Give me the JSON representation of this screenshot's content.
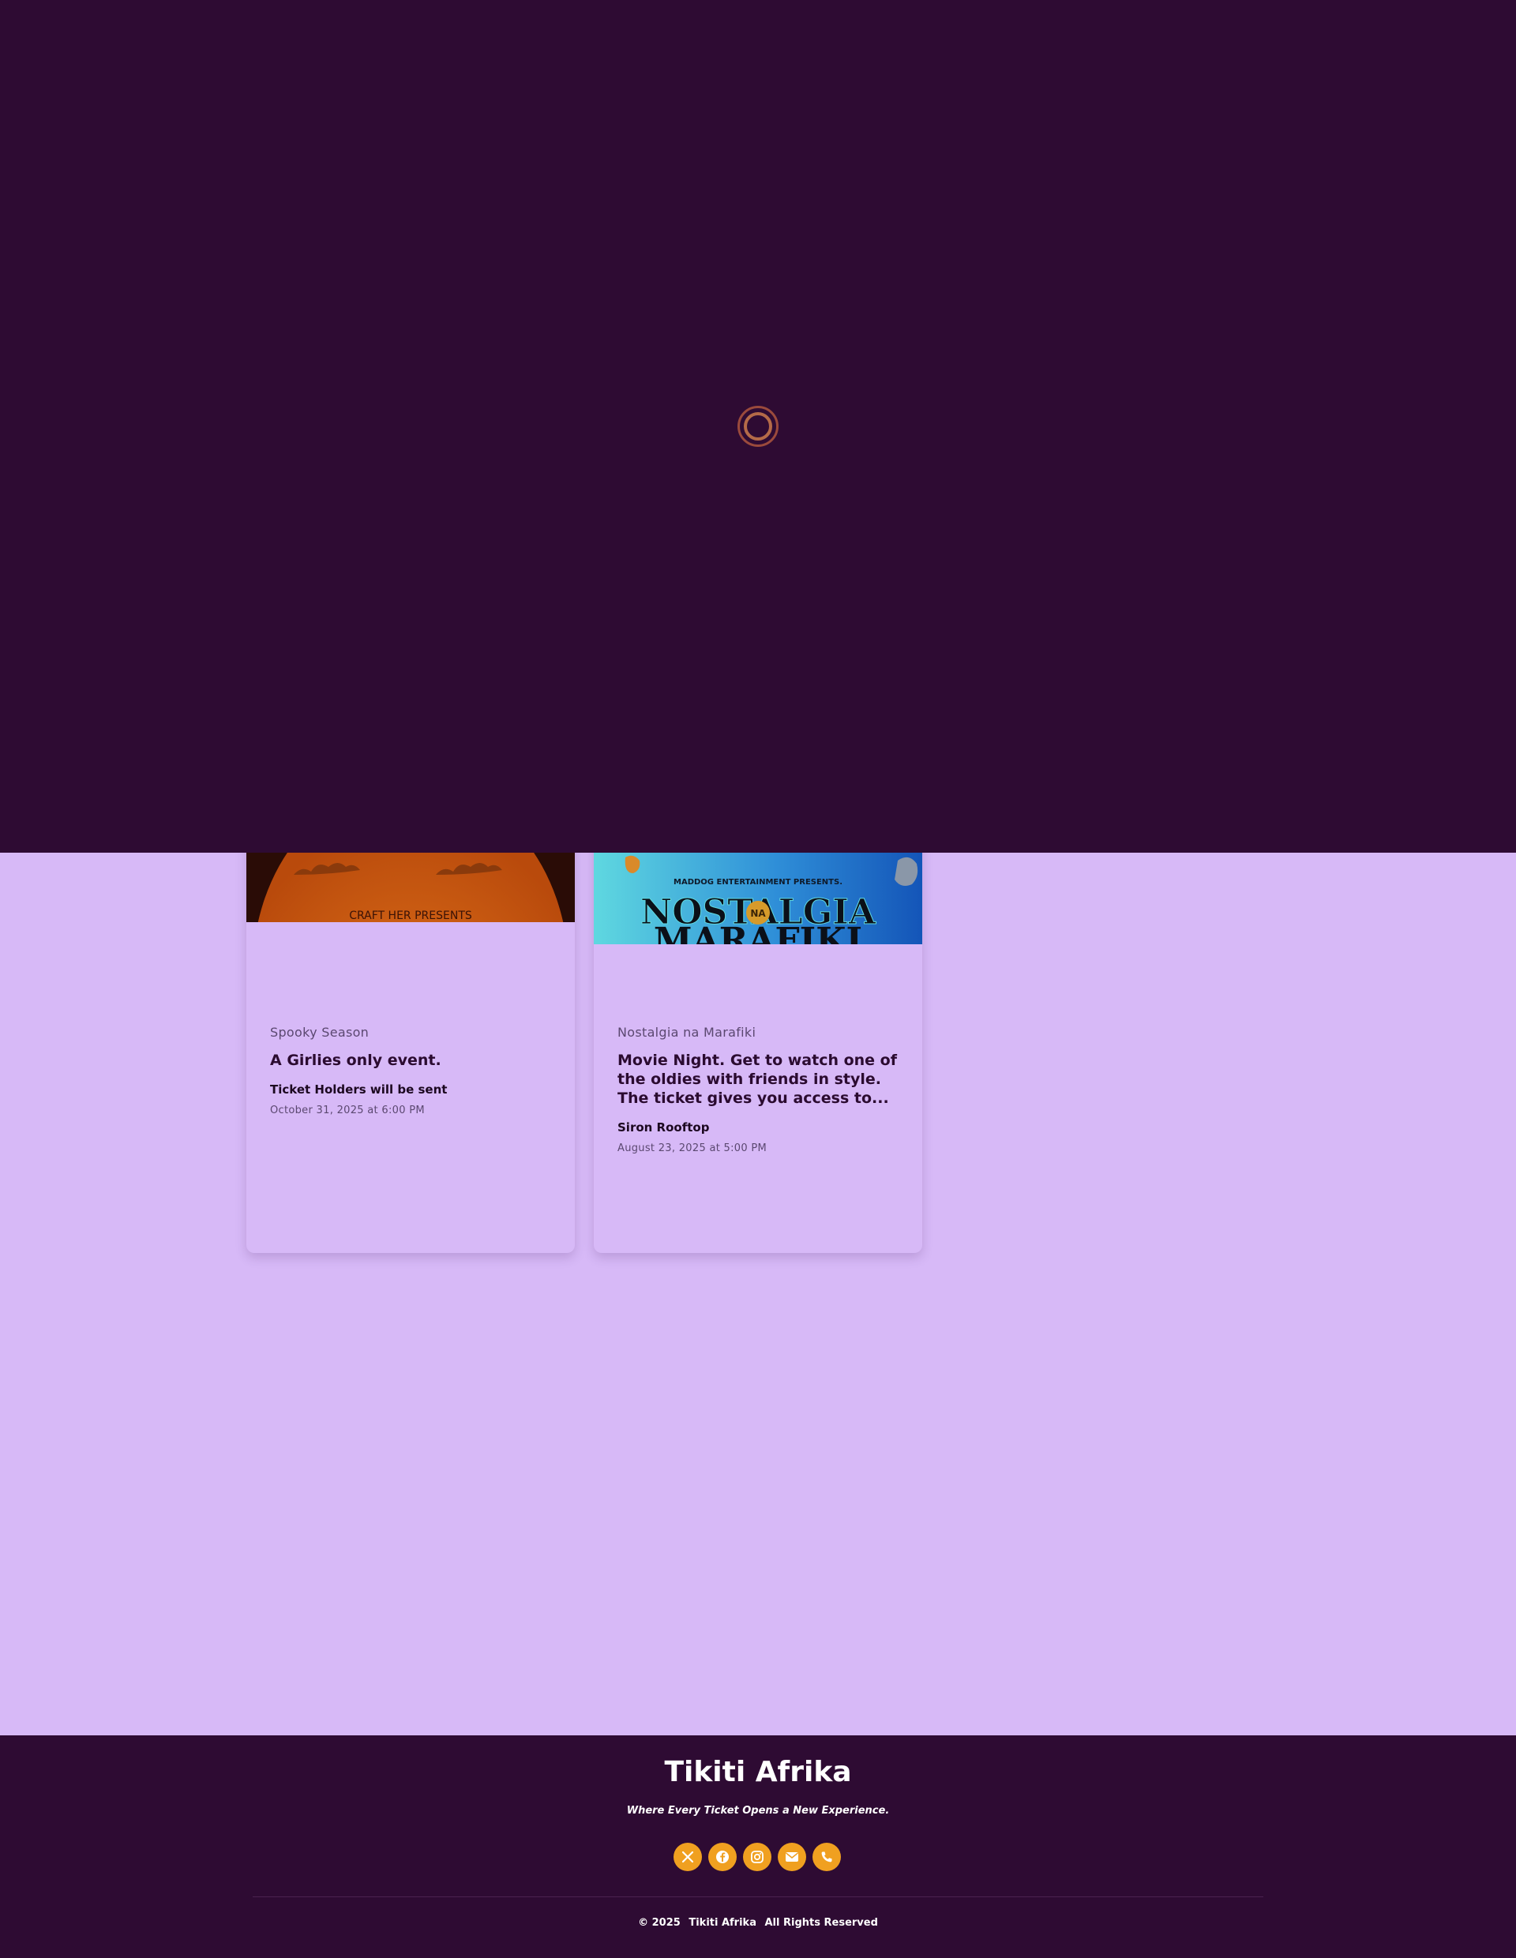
{
  "loader": {
    "icon": "loading-spinner"
  },
  "events": [
    {
      "category": "Spooky Season",
      "description": "A Girlies only event.",
      "venue": "Ticket Holders will be sent",
      "datetime": "October 31, 2025 at 6:00 PM",
      "poster_text": "CRAFT HER PRESENTS"
    },
    {
      "category": "Nostalgia na Marafiki",
      "description": "Movie Night. Get to watch one of the oldies with friends in style. The ticket gives you access to...",
      "venue": "Siron Rooftop",
      "datetime": "August 23, 2025 at 5:00 PM",
      "poster_top": "MADDOG ENTERTAINMENT PRESENTS.",
      "poster_title": "NOSTALGIA",
      "poster_badge": "NA",
      "poster_title2": "MARAFIKI"
    }
  ],
  "footer": {
    "brand": "Tikiti Afrika",
    "tagline": "Where Every Ticket Opens a New Experience.",
    "socials": [
      "x-icon",
      "facebook-icon",
      "instagram-icon",
      "mail-icon",
      "phone-icon"
    ],
    "copyright_prefix": "© 2025",
    "copyright_brand": "Tikiti Afrika",
    "copyright_suffix": "All Rights Reserved"
  },
  "colors": {
    "overlay": "#2e0b33",
    "page": "#d7b9f7",
    "accent": "#f0a020"
  }
}
